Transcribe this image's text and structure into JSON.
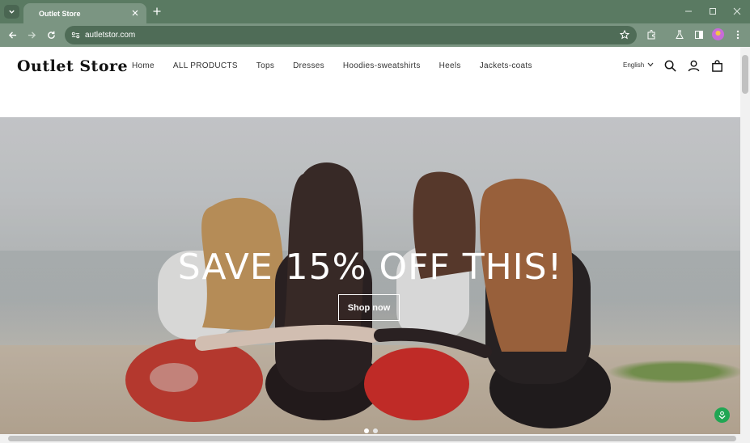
{
  "browser": {
    "tab_title": "Outlet Store",
    "url": "autletstor.com"
  },
  "store": {
    "logo": "Outlet Store",
    "nav": [
      "Home",
      "ALL PRODUCTS",
      "Tops",
      "Dresses",
      "Hoodies-sweatshirts",
      "Heels",
      "Jackets-coats"
    ],
    "language": "English"
  },
  "hero": {
    "headline": "SAVE 15% OFF THIS!",
    "cta": "Shop now",
    "slides_total": 2,
    "slide_active": 1
  },
  "colors": {
    "chrome": "#5a7a62",
    "toolbar": "#7b9582",
    "fab": "#20a653"
  },
  "icons": [
    "tab-search-icon",
    "close-icon",
    "plus-icon",
    "minimize-icon",
    "maximize-icon",
    "back-icon",
    "forward-icon",
    "reload-icon",
    "site-info-icon",
    "star-icon",
    "extensions-icon",
    "labs-icon",
    "side-panel-icon",
    "profile-avatar",
    "menu-dots-icon",
    "search-icon",
    "account-icon",
    "cart-icon",
    "chevron-down-icon",
    "download-icon"
  ]
}
